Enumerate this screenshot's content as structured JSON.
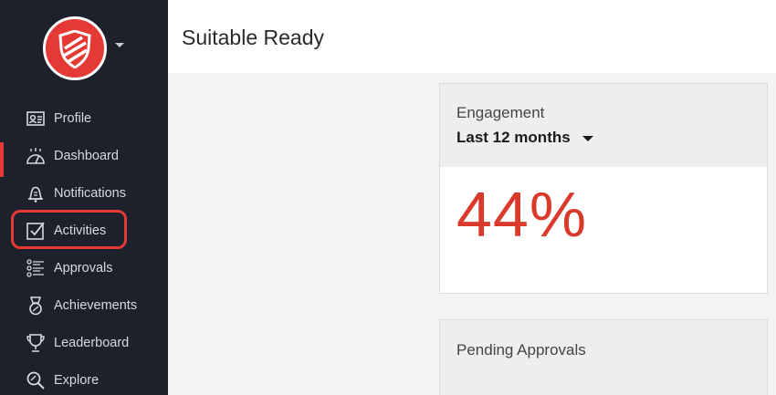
{
  "app": {
    "title": "Suitable Ready"
  },
  "brand": {
    "accent": "#e53935",
    "sidebar_bg": "#1c212b"
  },
  "sidebar": {
    "items": [
      {
        "label": "Profile",
        "icon": "profile-card-icon"
      },
      {
        "label": "Dashboard",
        "icon": "dashboard-icon"
      },
      {
        "label": "Notifications",
        "icon": "bell-icon"
      },
      {
        "label": "Activities",
        "icon": "checkbox-icon"
      },
      {
        "label": "Approvals",
        "icon": "checklist-icon"
      },
      {
        "label": "Achievements",
        "icon": "medal-icon"
      },
      {
        "label": "Leaderboard",
        "icon": "trophy-icon"
      },
      {
        "label": "Explore",
        "icon": "explore-search-icon"
      }
    ]
  },
  "engagement": {
    "label": "Engagement",
    "range": "Last 12 months",
    "value": "44%"
  },
  "pending": {
    "label": "Pending Approvals"
  }
}
